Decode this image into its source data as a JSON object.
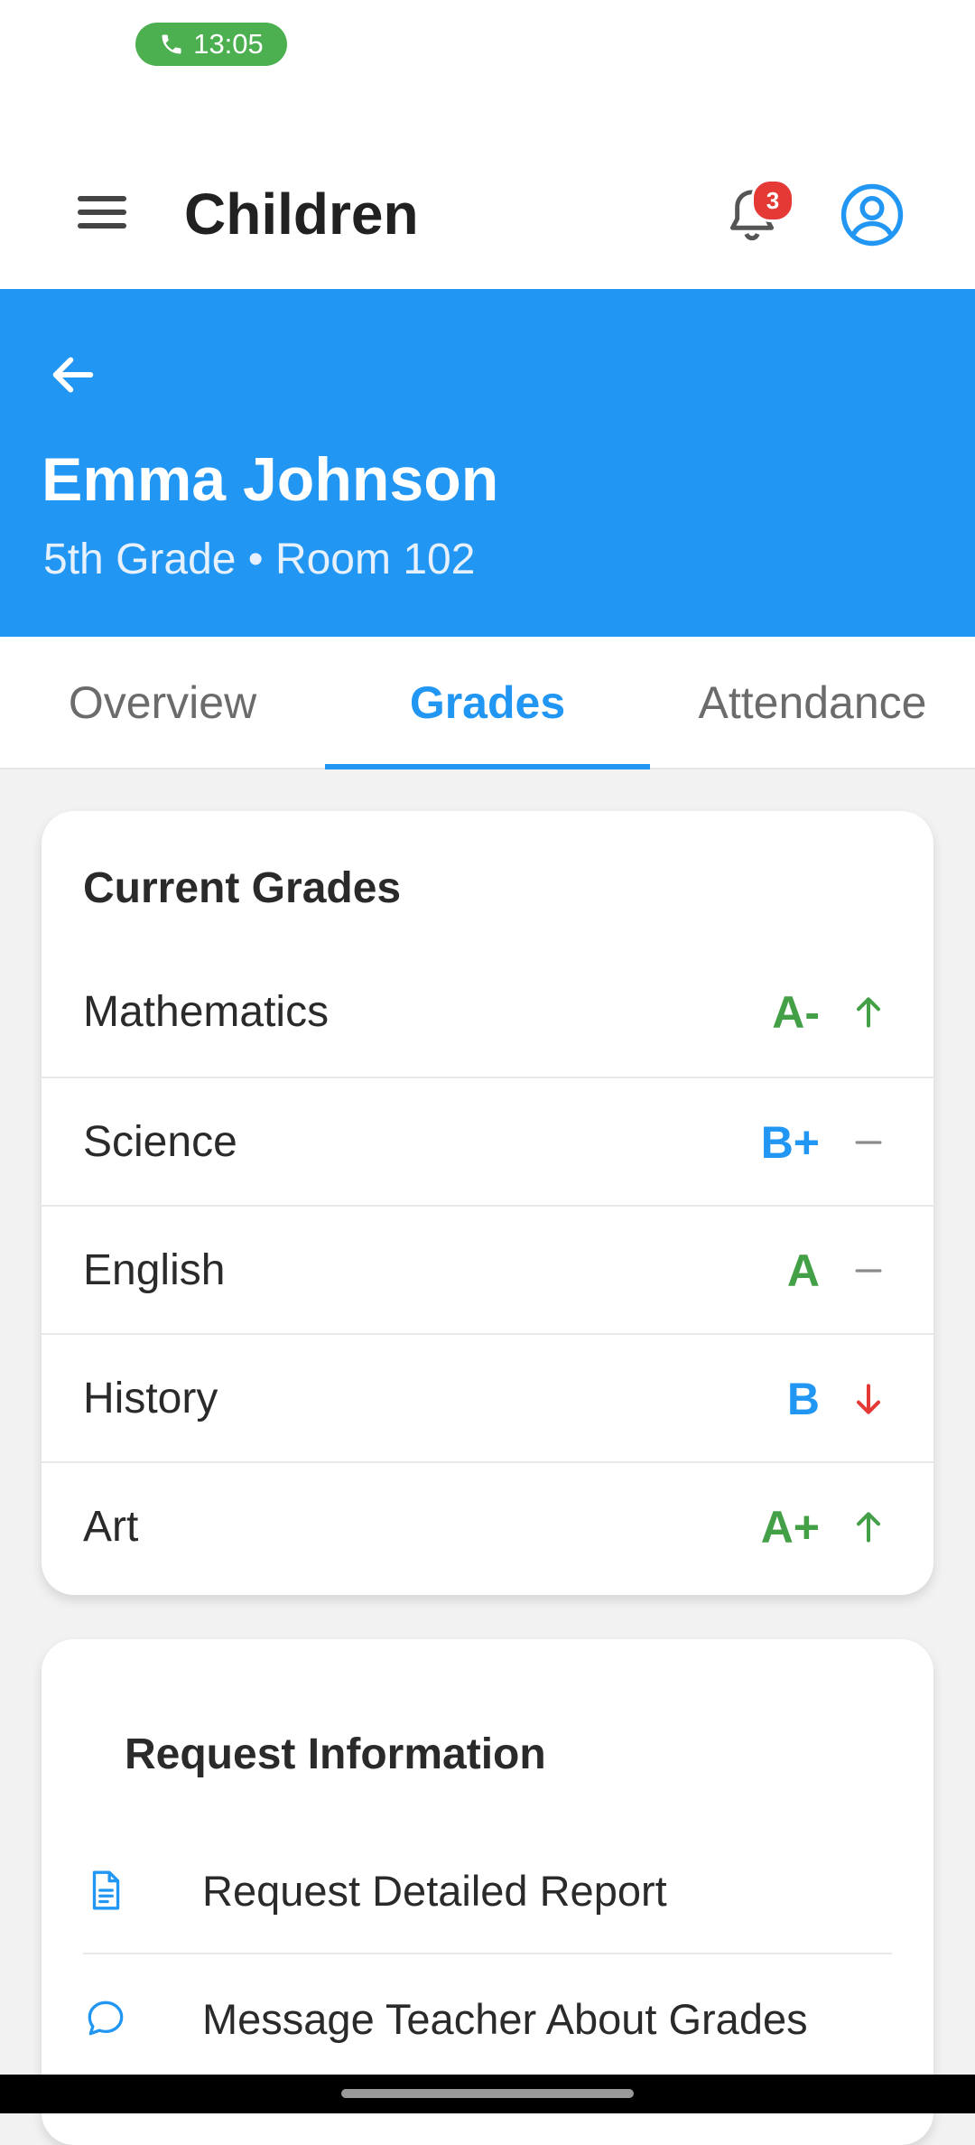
{
  "status_bar": {
    "call_time": "13:05"
  },
  "app_bar": {
    "title": "Children",
    "notification_count": "3"
  },
  "child": {
    "name": "Emma Johnson",
    "subtitle": "5th Grade • Room 102"
  },
  "tabs": [
    {
      "label": "Overview",
      "active": false
    },
    {
      "label": "Grades",
      "active": true
    },
    {
      "label": "Attendance",
      "active": false
    }
  ],
  "current_grades": {
    "title": "Current Grades",
    "rows": [
      {
        "subject": "Mathematics",
        "grade": "A-",
        "grade_color": "#43a047",
        "trend": "up-arrow-icon"
      },
      {
        "subject": "Science",
        "grade": "B+",
        "grade_color": "#2196f3",
        "trend": "dash-icon"
      },
      {
        "subject": "English",
        "grade": "A",
        "grade_color": "#43a047",
        "trend": "dash-icon"
      },
      {
        "subject": "History",
        "grade": "B",
        "grade_color": "#2196f3",
        "trend": "down-arrow-icon"
      },
      {
        "subject": "Art",
        "grade": "A+",
        "grade_color": "#43a047",
        "trend": "up-arrow-icon"
      }
    ]
  },
  "request_information": {
    "title": "Request Information",
    "items": [
      {
        "label": "Request Detailed Report",
        "icon": "document-icon"
      },
      {
        "label": "Message Teacher About Grades",
        "icon": "chat-bubble-icon"
      }
    ]
  },
  "colors": {
    "primary": "#2196f3",
    "grade_green": "#43a047",
    "trend_up": "#43a047",
    "trend_down": "#e53935",
    "badge": "#e53935"
  }
}
